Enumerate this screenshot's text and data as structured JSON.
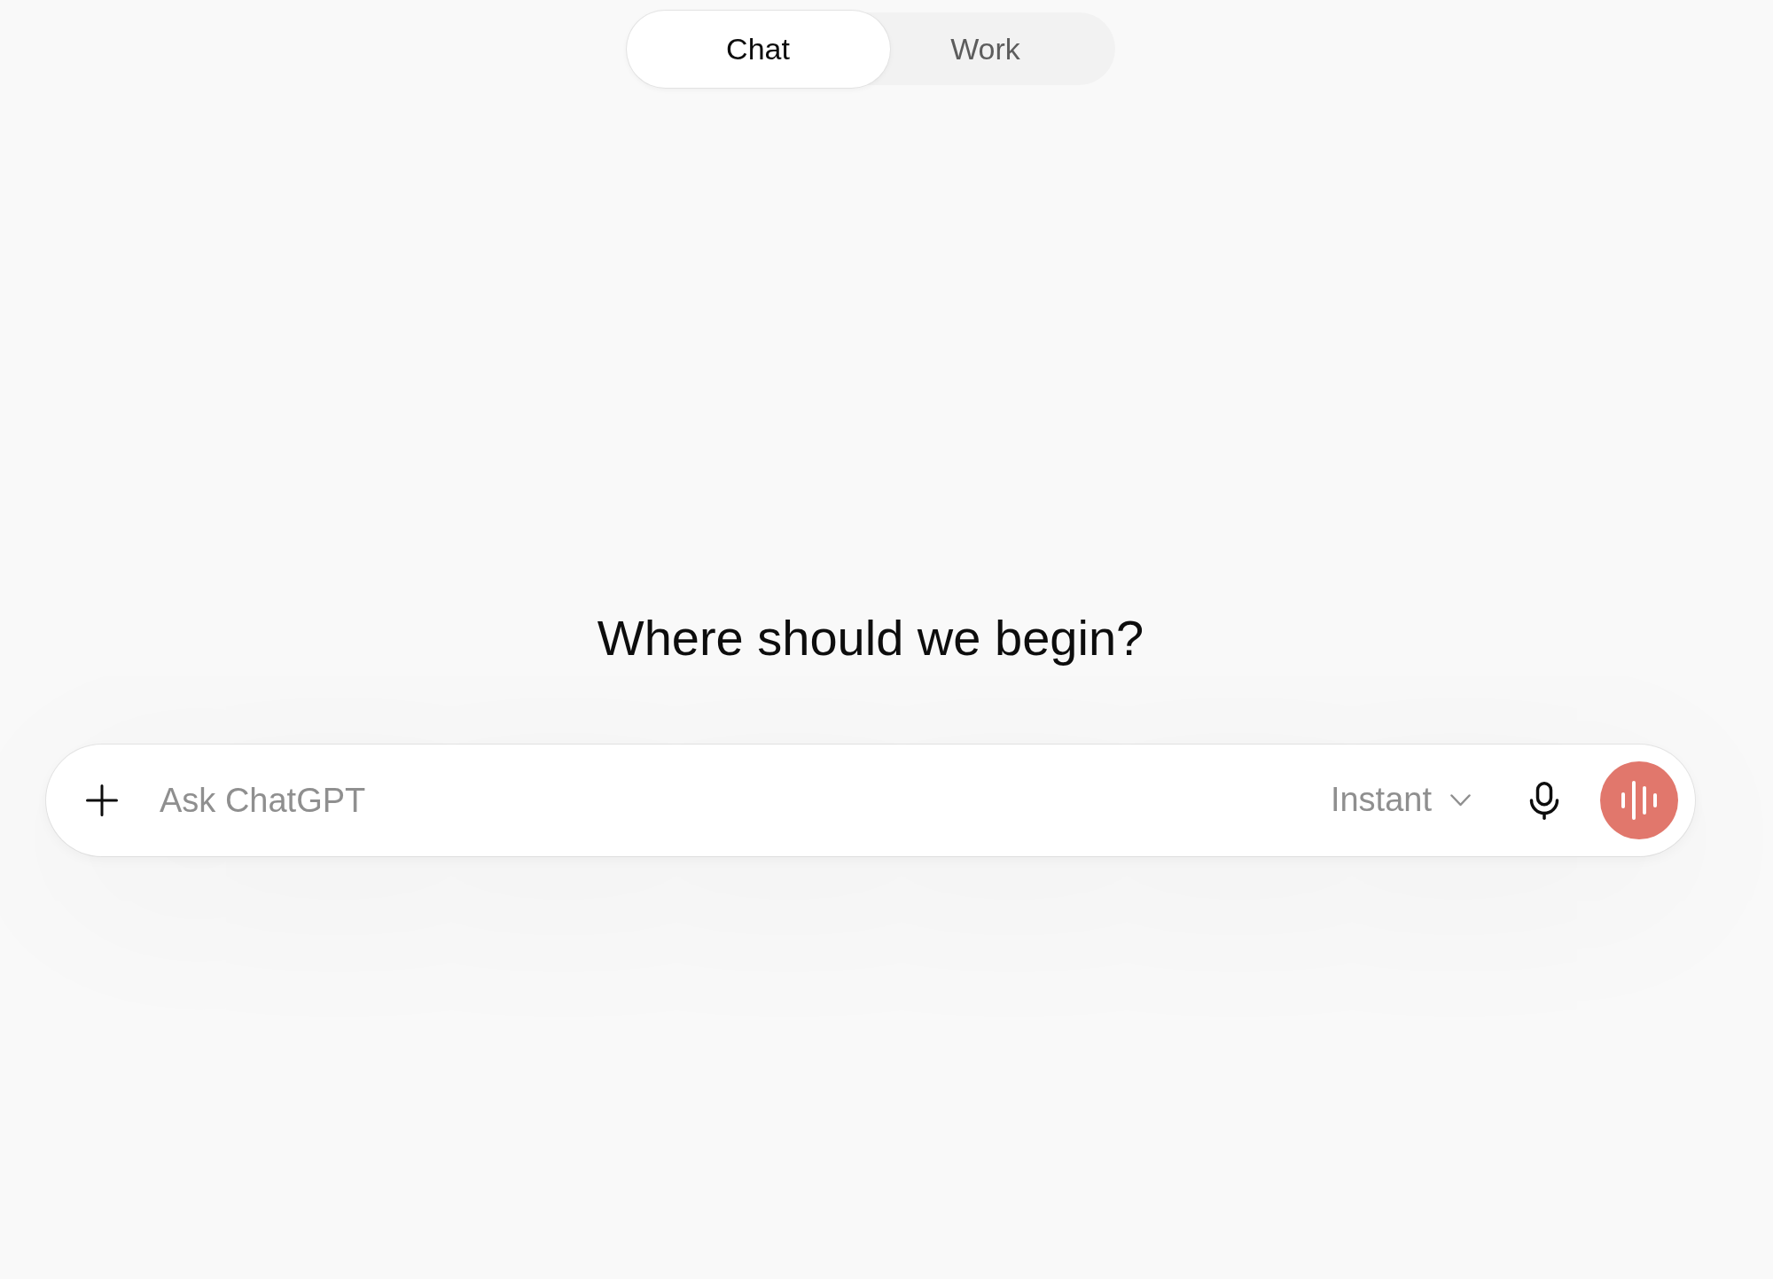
{
  "tabs": [
    {
      "label": "Chat",
      "selected": true
    },
    {
      "label": "Work",
      "selected": false
    }
  ],
  "heading": "Where should we begin?",
  "composer": {
    "placeholder": "Ask ChatGPT",
    "model": "Instant"
  }
}
